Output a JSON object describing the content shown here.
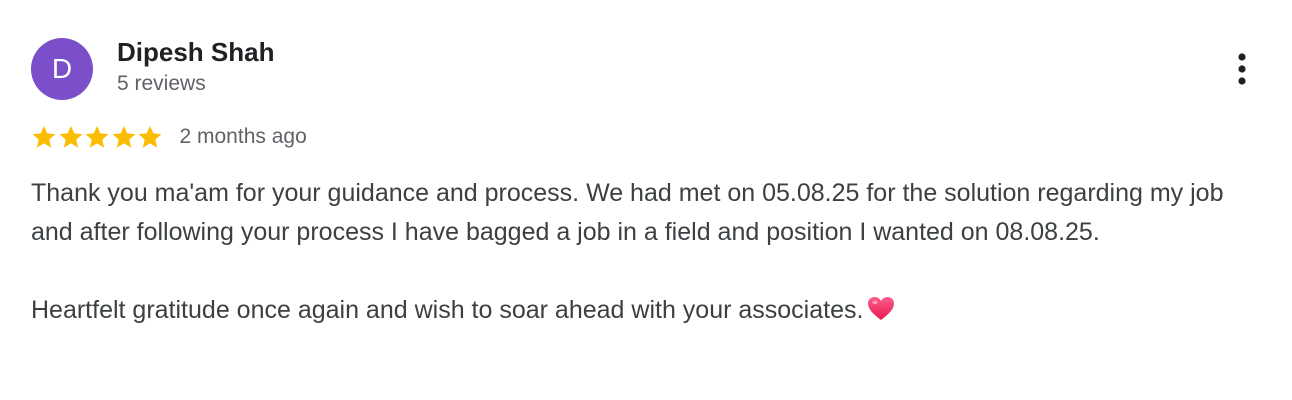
{
  "reviewer": {
    "avatar_letter": "D",
    "avatar_color": "#7b4fc9",
    "name": "Dipesh Shah",
    "reviews_count": "5 reviews"
  },
  "review": {
    "rating": 5,
    "rating_max": 5,
    "star_color": "#fbbc04",
    "date": "2 months ago",
    "paragraph_1": "Thank you ma'am for your guidance and process. We had met on 05.08.25 for the solution regarding my job and after following your process I have bagged a job in a field and position I wanted on 08.08.25.",
    "paragraph_2": "Heartfelt gratitude once again and wish to soar ahead with your associates.",
    "emoji": "heart-icon"
  },
  "icons": {
    "more": "more-vert-icon"
  }
}
